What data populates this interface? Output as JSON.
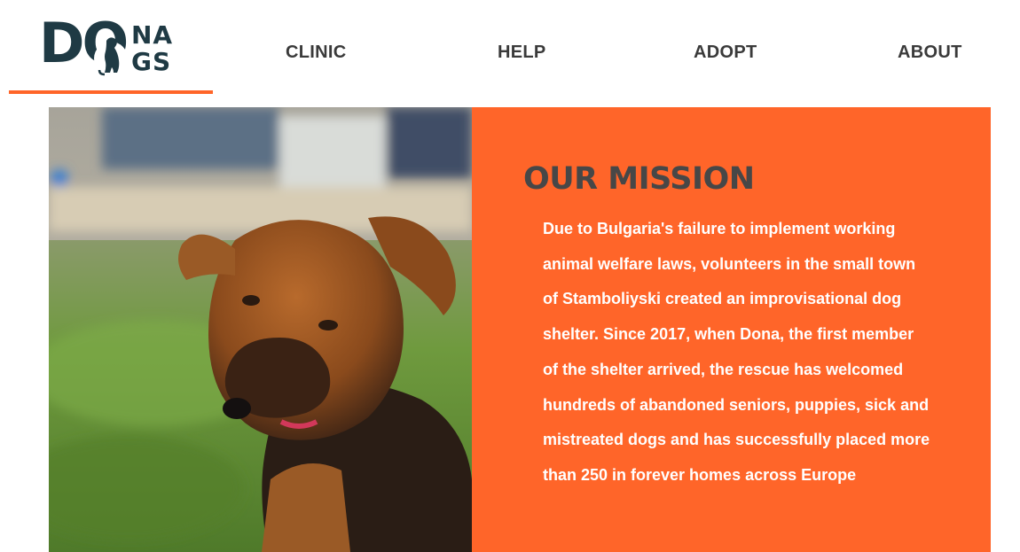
{
  "colors": {
    "accent": "#ff6529",
    "dark": "#1f3a44",
    "nav_text": "#3a3a3a",
    "heading": "#474747"
  },
  "header": {
    "logo": {
      "line1": "DO",
      "line2a": "NA",
      "line2b": "GS",
      "icon": "dog-silhouette-icon"
    },
    "nav": [
      {
        "label": "CLINIC"
      },
      {
        "label": "HELP"
      },
      {
        "label": "ADOPT"
      },
      {
        "label": "ABOUT"
      }
    ]
  },
  "hero": {
    "image": "dog-photo",
    "mission": {
      "title": "OUR MISSION",
      "text": "Due to Bulgaria's failure to implement working animal welfare laws, volunteers in the small town of Stamboliyski created an improvisational dog shelter. Since 2017, when Dona, the first member of the shelter arrived, the rescue has welcomed hundreds of abandoned seniors, puppies, sick and mistreated dogs and has successfully placed more than 250 in forever homes across Europe"
    }
  }
}
